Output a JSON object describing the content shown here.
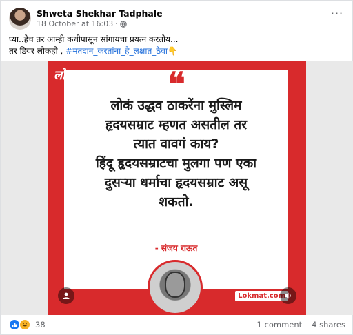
{
  "post": {
    "author": "Shweta Shekhar Tadphale",
    "timestamp": "18 October at 16:03",
    "separator": "·",
    "more_label": "···",
    "line1": "घ्या..हेच तर आम्ही कधीपासून सांगायचा प्रयत्न करतोय...",
    "line2_prefix": "तर डियर लोकहो , ",
    "hashtag": "#मतदान_करतांना_हे_लक्षात_ठेवा",
    "emoji": "👇"
  },
  "image": {
    "logo": "लोकमत",
    "quote_marks": "❝",
    "quote_lines": [
      "लोकं उद्धव ठाकरेंना मुस्लिम",
      "हृदयसम्राट म्हणत असतील तर",
      "त्यात वावगं काय?",
      "हिंदू हृदयसम्राटचा मुलगा पण एका",
      "दुसऱ्या धर्माचा हृदयसम्राट असू",
      "शकतो."
    ],
    "attribution": "- संजय राऊत",
    "badge": "Lokmat.com"
  },
  "footer": {
    "reaction_count": "38",
    "comments": "1 comment",
    "shares": "4 shares"
  },
  "colors": {
    "brand_red": "#d82a2c",
    "link_blue": "#216fdb",
    "secondary_text": "#65676b"
  }
}
